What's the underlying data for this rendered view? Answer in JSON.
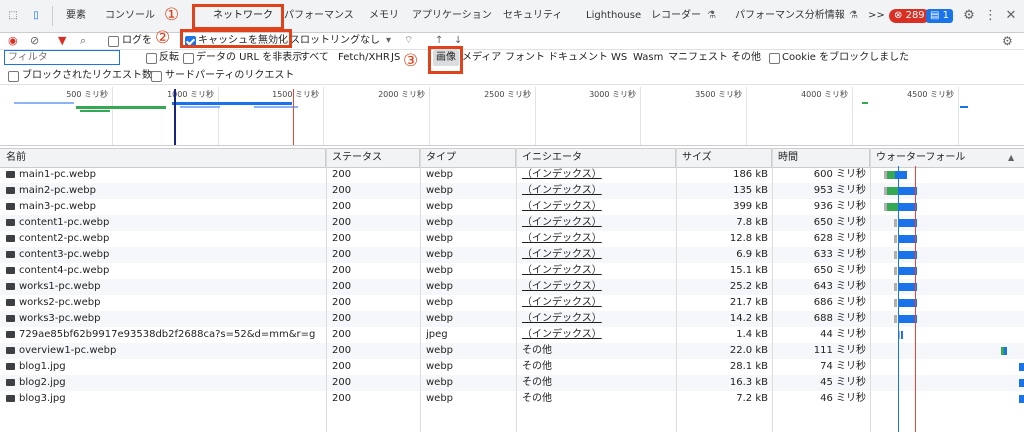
{
  "tabs": [
    "要素",
    "コンソール",
    "ネットワーク",
    "パフォーマンス",
    "メモリ",
    "アプリケーション",
    "セキュリティ",
    "Lighthouse",
    "レコーダー",
    "パフォーマンス分析情報"
  ],
  "tab_overflow": ">>",
  "error_count": "289",
  "message_count": "1",
  "annotations": [
    "①",
    "②",
    "③"
  ],
  "toolbar": {
    "preserve_log": "ログを",
    "disable_cache": "キャッシュを無効化",
    "throttling": "スロットリングなし"
  },
  "filter": {
    "placeholder": "フィルタ",
    "invert": "反転",
    "hide_data_urls": "データの URL を非表示",
    "all": "すべて",
    "types": [
      "Fetch/XHR",
      "JS",
      "画像",
      "メディア",
      "フォント",
      "ドキュメント",
      "WS",
      "Wasm",
      "マニフェスト",
      "その他"
    ],
    "block_cookies": "Cookie をブロックしました",
    "blocked_requests": "ブロックされたリクエスト数",
    "third_party": "サードパーティのリクエスト"
  },
  "overview_ticks": [
    "500 ミリ秒",
    "1000 ミリ秒",
    "1500 ミリ秒",
    "2000 ミリ秒",
    "2500 ミリ秒",
    "3000 ミリ秒",
    "3500 ミリ秒",
    "4000 ミリ秒",
    "4500 ミリ秒"
  ],
  "columns": [
    "名前",
    "ステータス",
    "タイプ",
    "イニシエータ",
    "サイズ",
    "時間",
    "ウォーターフォール"
  ],
  "rows": [
    {
      "name": "main1-pc.webp",
      "status": "200",
      "type": "webp",
      "initiator": "（インデックス）",
      "size": "186 kB",
      "time": "600 ミリ秒"
    },
    {
      "name": "main2-pc.webp",
      "status": "200",
      "type": "webp",
      "initiator": "（インデックス）",
      "size": "135 kB",
      "time": "953 ミリ秒"
    },
    {
      "name": "main3-pc.webp",
      "status": "200",
      "type": "webp",
      "initiator": "（インデックス）",
      "size": "399 kB",
      "time": "936 ミリ秒"
    },
    {
      "name": "content1-pc.webp",
      "status": "200",
      "type": "webp",
      "initiator": "（インデックス）",
      "size": "7.8 kB",
      "time": "650 ミリ秒"
    },
    {
      "name": "content2-pc.webp",
      "status": "200",
      "type": "webp",
      "initiator": "（インデックス）",
      "size": "12.8 kB",
      "time": "628 ミリ秒"
    },
    {
      "name": "content3-pc.webp",
      "status": "200",
      "type": "webp",
      "initiator": "（インデックス）",
      "size": "6.9 kB",
      "time": "633 ミリ秒"
    },
    {
      "name": "content4-pc.webp",
      "status": "200",
      "type": "webp",
      "initiator": "（インデックス）",
      "size": "15.1 kB",
      "time": "650 ミリ秒"
    },
    {
      "name": "works1-pc.webp",
      "status": "200",
      "type": "webp",
      "initiator": "（インデックス）",
      "size": "25.2 kB",
      "time": "643 ミリ秒"
    },
    {
      "name": "works2-pc.webp",
      "status": "200",
      "type": "webp",
      "initiator": "（インデックス）",
      "size": "21.7 kB",
      "time": "686 ミリ秒"
    },
    {
      "name": "works3-pc.webp",
      "status": "200",
      "type": "webp",
      "initiator": "（インデックス）",
      "size": "14.2 kB",
      "time": "688 ミリ秒"
    },
    {
      "name": "729ae85bf62b9917e93538db2f2688ca?s=52&d=mm&r=g",
      "status": "200",
      "type": "jpeg",
      "initiator": "（インデックス）",
      "size": "1.4 kB",
      "time": "44 ミリ秒"
    },
    {
      "name": "overview1-pc.webp",
      "status": "200",
      "type": "webp",
      "initiator": "その他",
      "size": "22.0 kB",
      "time": "111 ミリ秒"
    },
    {
      "name": "blog1.jpg",
      "status": "200",
      "type": "webp",
      "initiator": "その他",
      "size": "28.1 kB",
      "time": "74 ミリ秒"
    },
    {
      "name": "blog2.jpg",
      "status": "200",
      "type": "webp",
      "initiator": "その他",
      "size": "16.3 kB",
      "time": "45 ミリ秒"
    },
    {
      "name": "blog3.jpg",
      "status": "200",
      "type": "webp",
      "initiator": "その他",
      "size": "7.2 kB",
      "time": "46 ミリ秒"
    }
  ]
}
